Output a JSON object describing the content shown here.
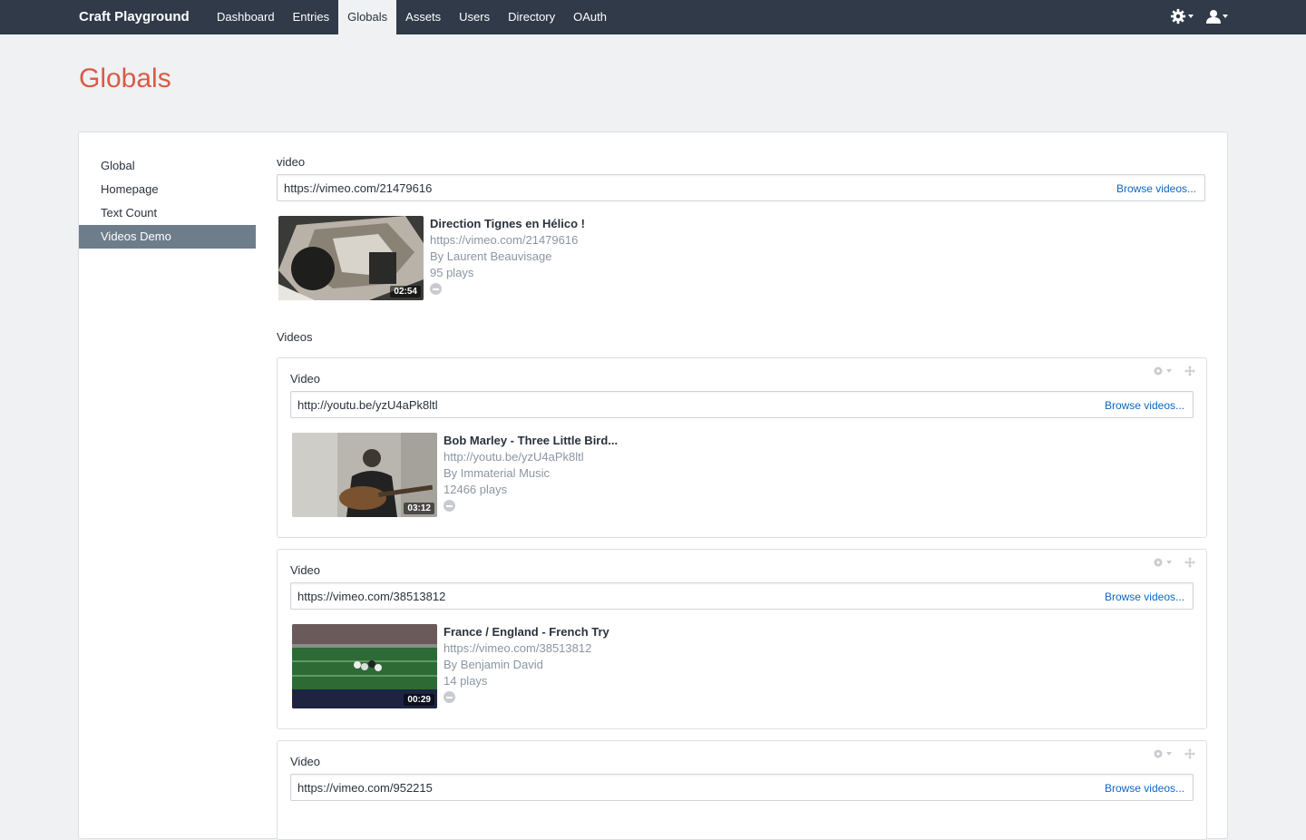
{
  "topbar": {
    "brand": "Craft Playground",
    "nav": [
      "Dashboard",
      "Entries",
      "Globals",
      "Assets",
      "Users",
      "Directory",
      "OAuth"
    ],
    "active_nav": "Globals"
  },
  "page": {
    "title": "Globals"
  },
  "sidebar": {
    "items": [
      {
        "label": "Global"
      },
      {
        "label": "Homepage"
      },
      {
        "label": "Text Count"
      },
      {
        "label": "Videos Demo"
      }
    ],
    "selected": "Videos Demo"
  },
  "video_field": {
    "label": "video",
    "url": "https://vimeo.com/21479616",
    "browse_label": "Browse videos...",
    "card": {
      "title": "Direction Tignes en Hélico !",
      "url": "https://vimeo.com/21479616",
      "author": "By Laurent Beauvisage",
      "plays": "95 plays",
      "duration": "02:54"
    }
  },
  "videos_field": {
    "label": "Videos",
    "blocks": [
      {
        "label": "Video",
        "url": "http://youtu.be/yzU4aPk8ltl",
        "browse_label": "Browse videos...",
        "card": {
          "title": "Bob Marley - Three Little Bird...",
          "url": "http://youtu.be/yzU4aPk8ltl",
          "author": "By Immaterial Music",
          "plays": "12466 plays",
          "duration": "03:12"
        }
      },
      {
        "label": "Video",
        "url": "https://vimeo.com/38513812",
        "browse_label": "Browse videos...",
        "card": {
          "title": "France / England - French Try",
          "url": "https://vimeo.com/38513812",
          "author": "By Benjamin David",
          "plays": "14 plays",
          "duration": "00:29"
        }
      },
      {
        "label": "Video",
        "url": "https://vimeo.com/952215",
        "browse_label": "Browse videos..."
      }
    ]
  },
  "colors": {
    "topbar": "#303a48",
    "title": "#da5a47",
    "link": "#0d66c2",
    "selected_sidebar": "#6e7d8c"
  }
}
